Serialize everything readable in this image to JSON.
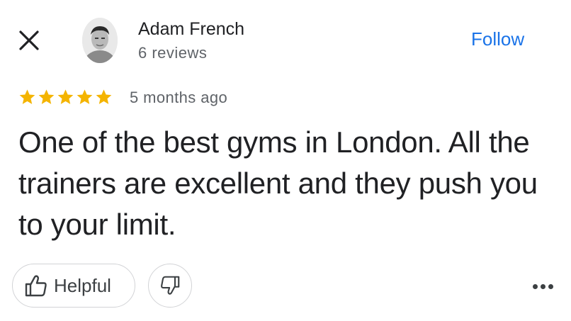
{
  "reviewer": {
    "name": "Adam French",
    "meta": "6 reviews"
  },
  "follow_label": "Follow",
  "review": {
    "rating": 5,
    "rating_max": 5,
    "time": "5 months ago",
    "text": "One of the best gyms in London. All the trainers are excellent and they push you to your limit."
  },
  "actions": {
    "helpful_label": "Helpful"
  },
  "colors": {
    "accent": "#1a73e8",
    "star": "#f4b400",
    "text": "#202124",
    "muted": "#5f6368"
  },
  "icons": {
    "close": "close-icon",
    "thumb_up": "thumb-up-icon",
    "thumb_down": "thumb-down-icon",
    "more": "more-horizontal-icon"
  }
}
